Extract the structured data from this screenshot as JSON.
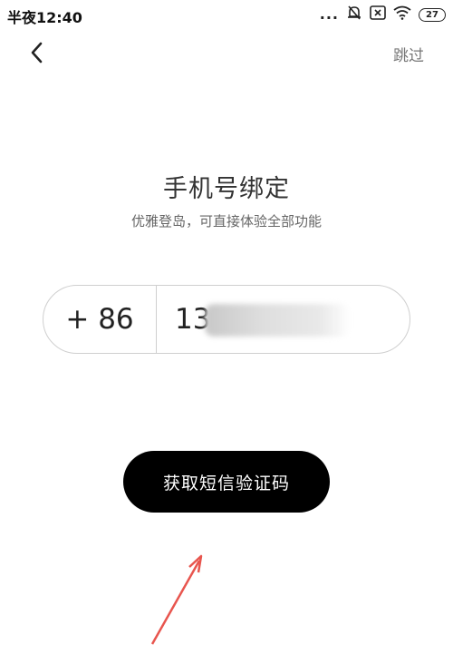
{
  "status_bar": {
    "time": "半夜12:40",
    "dots": "...",
    "battery": "27",
    "icons": [
      "mute-bell-icon",
      "close-box-icon",
      "wifi-icon",
      "battery-icon"
    ]
  },
  "nav": {
    "back_icon": "chevron-left-icon",
    "skip_label": "跳过"
  },
  "main": {
    "title": "手机号绑定",
    "subtitle": "优雅登岛，可直接体验全部功能",
    "country_code": "+ 86",
    "phone_value": "13"
  },
  "actions": {
    "get_code_label": "获取短信验证码"
  },
  "colors": {
    "button_bg": "#000000",
    "annotation_arrow": "#e8554e"
  }
}
